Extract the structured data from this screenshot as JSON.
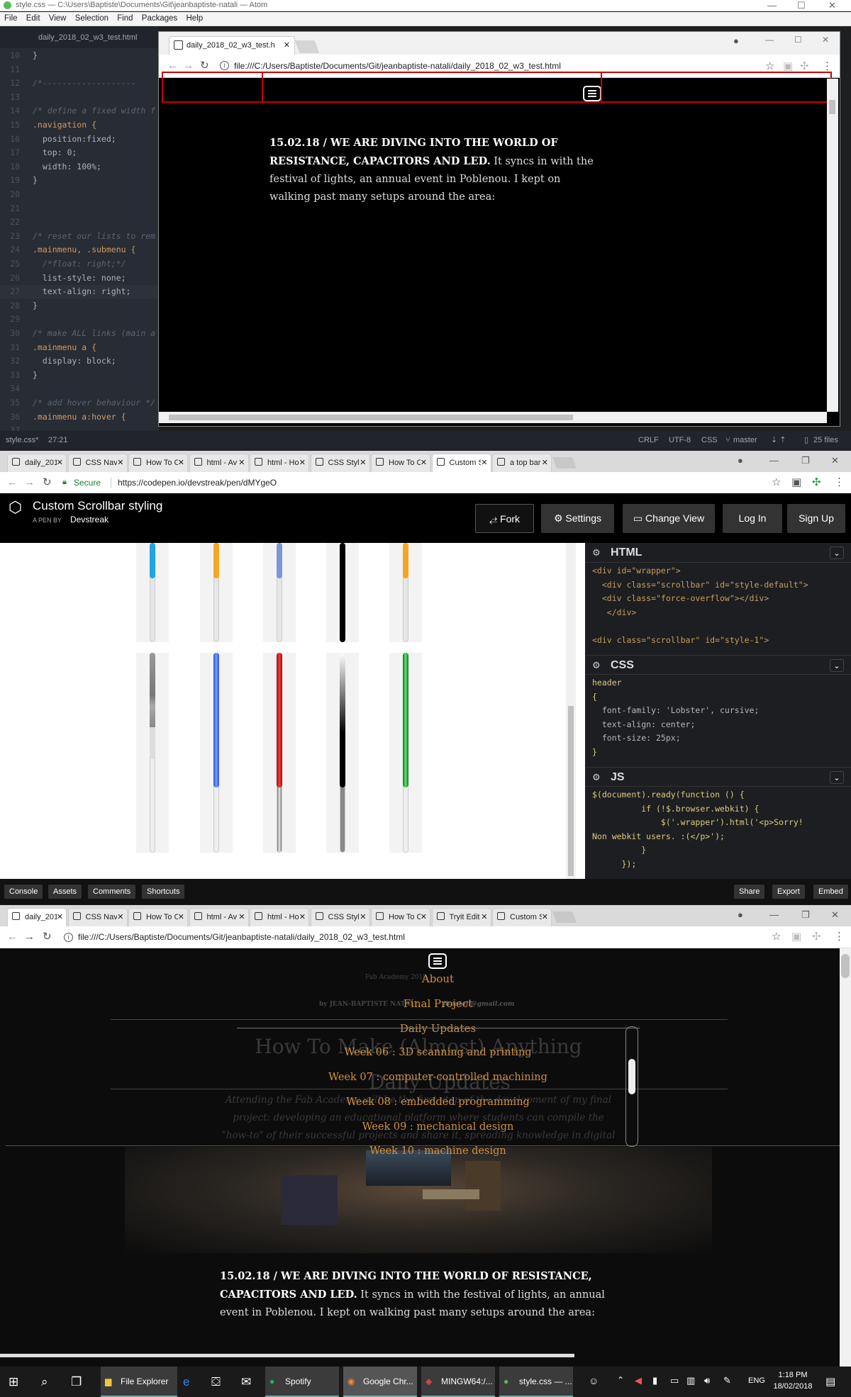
{
  "atom": {
    "title": "style.css — C:\\Users\\Baptiste\\Documents\\Git\\jeanbaptiste-natali — Atom",
    "menu": [
      "File",
      "Edit",
      "View",
      "Selection",
      "Find",
      "Packages",
      "Help"
    ],
    "tab": "daily_2018_02_w3_test.html",
    "code_lines": [
      {
        "n": "10",
        "t": "}"
      },
      {
        "n": "11",
        "t": ""
      },
      {
        "n": "12",
        "t": "/*-------------------"
      },
      {
        "n": "13",
        "t": ""
      },
      {
        "n": "14",
        "t": "/* define a fixed width f"
      },
      {
        "n": "15",
        "t": ".navigation {"
      },
      {
        "n": "16",
        "t": "  position:fixed;"
      },
      {
        "n": "17",
        "t": "  top: 0;"
      },
      {
        "n": "18",
        "t": "  width: 100%;"
      },
      {
        "n": "19",
        "t": "}"
      },
      {
        "n": "20",
        "t": ""
      },
      {
        "n": "21",
        "t": ""
      },
      {
        "n": "22",
        "t": ""
      },
      {
        "n": "23",
        "t": "/* reset our lists to rem"
      },
      {
        "n": "24",
        "t": ".mainmenu, .submenu {"
      },
      {
        "n": "25",
        "t": "  /*float: right;*/"
      },
      {
        "n": "26",
        "t": "  list-style: none;"
      },
      {
        "n": "27",
        "t": "  text-align: right;"
      },
      {
        "n": "28",
        "t": "}"
      },
      {
        "n": "29",
        "t": ""
      },
      {
        "n": "30",
        "t": "/* make ALL links (main a"
      },
      {
        "n": "31",
        "t": ".mainmenu a {"
      },
      {
        "n": "32",
        "t": "  display: block;"
      },
      {
        "n": "33",
        "t": "}"
      },
      {
        "n": "34",
        "t": ""
      },
      {
        "n": "35",
        "t": "/* add hover behaviour */"
      },
      {
        "n": "36",
        "t": ".mainmenu a:hover {"
      },
      {
        "n": "37",
        "t": ""
      }
    ],
    "status": {
      "file": "style.css*",
      "cursor": "27:21",
      "line_ending": "CRLF",
      "encoding": "UTF-8",
      "grammar": "CSS",
      "branch": "master",
      "files": "25 files"
    }
  },
  "chrome1": {
    "tab_title": "daily_2018_02_w3_test.h",
    "url": "file:///C:/Users/Baptiste/Documents/Git/jeanbaptiste-natali/daily_2018_02_w3_test.html",
    "para_bold": "15.02.18 / WE ARE DIVING INTO THE WORLD OF RESISTANCE, CAPACITORS AND LED.",
    "para_rest": " It syncs in with the festival of lights, an annual event in Poblenou. I kept on walking past many setups around the area:"
  },
  "chrome2": {
    "tabs": [
      "daily_201",
      "CSS Navi",
      "How To C",
      "html - Av",
      "html - Ho",
      "CSS Stylin",
      "How To C",
      "Custom S",
      "a top bar"
    ],
    "secure": "Secure",
    "url": "https://codepen.io/devstreak/pen/dMYgeO",
    "pen_title": "Custom Scrollbar styling",
    "pen_by_prefix": "A PEN BY",
    "pen_author": "Devstreak",
    "buttons": {
      "fork": "Fork",
      "settings": "Settings",
      "change_view": "Change View",
      "login": "Log In",
      "signup": "Sign Up"
    },
    "html_label": "HTML",
    "css_label": "CSS",
    "js_label": "JS",
    "html_code": [
      "<div id=\"wrapper\">",
      "  <div class=\"scrollbar\" id=\"style-default\">",
      "  <div class=\"force-overflow\"></div>",
      "   </div>",
      "",
      "<div class=\"scrollbar\" id=\"style-1\">"
    ],
    "css_code": [
      "header",
      "{",
      "  font-family: 'Lobster', cursive;",
      "  text-align: center;",
      "  font-size: 25px;",
      "}"
    ],
    "js_code": [
      "$(document).ready(function () {",
      "          if (!$.browser.webkit) {",
      "              $('.wrapper').html('<p>Sorry!",
      "Non webkit users. :(</p>');",
      "          }",
      "      });"
    ],
    "footer_left": [
      "Console",
      "Assets",
      "Comments",
      "Shortcuts"
    ],
    "footer_right": [
      "Share",
      "Export",
      "Embed"
    ],
    "scrollbar_colors": {
      "row1": [
        "#1ea4e9",
        "#f5a623",
        "#7d96d8",
        "#000000",
        "#f5a623"
      ],
      "row2": [
        "#999999",
        "#3b6ee8",
        "#cc1f1f",
        "#888888",
        "#1f9a30"
      ]
    }
  },
  "chrome3": {
    "tabs": [
      "daily_201",
      "CSS Navi",
      "How To C",
      "html - Av",
      "html - Ho",
      "CSS Stylin",
      "How To C",
      "Tryit Edit",
      "Custom S"
    ],
    "url": "file:///C:/Users/Baptiste/Documents/Git/jeanbaptiste-natali/daily_2018_02_w3_test.html",
    "menu": [
      "About",
      "Final Project",
      "Daily Updates",
      "Week 06 : 3D scanning and printing",
      "Week 07 : computer-controlled machining",
      "Week 08 : embedded programming",
      "Week 09 : mechanical design",
      "Week 10 : machine design"
    ],
    "ghost_site": "Fab Academy 2018",
    "ghost_byline": "by JEAN-BAPTISTE NATALI",
    "ghost_email": "jbnatali@gmail.com",
    "ghost_heading": "How To Make (Almost) Anything",
    "ghost_sub": "Daily Updates",
    "ghost_body": "Attending the Fab Academy will be the first step of the development of my final project: developing an educational platform where students can compile the \"how-to\" of their successful projects and share it, spreading knowledge in digital fabrication across fab labs worldwide.",
    "para_bold": "15.02.18 / WE ARE DIVING INTO THE WORLD OF RESISTANCE, CAPACITORS AND LED.",
    "para_rest": " It syncs in with the festival of lights, an annual event in Poblenou. I kept on walking past many setups around the area:"
  },
  "taskbar": {
    "apps": [
      "File Explorer",
      "Spotify",
      "Google Chr...",
      "MINGW64:/...",
      "style.css — ..."
    ],
    "lang": "ENG",
    "time": "1:18 PM",
    "date": "18/02/2018"
  }
}
